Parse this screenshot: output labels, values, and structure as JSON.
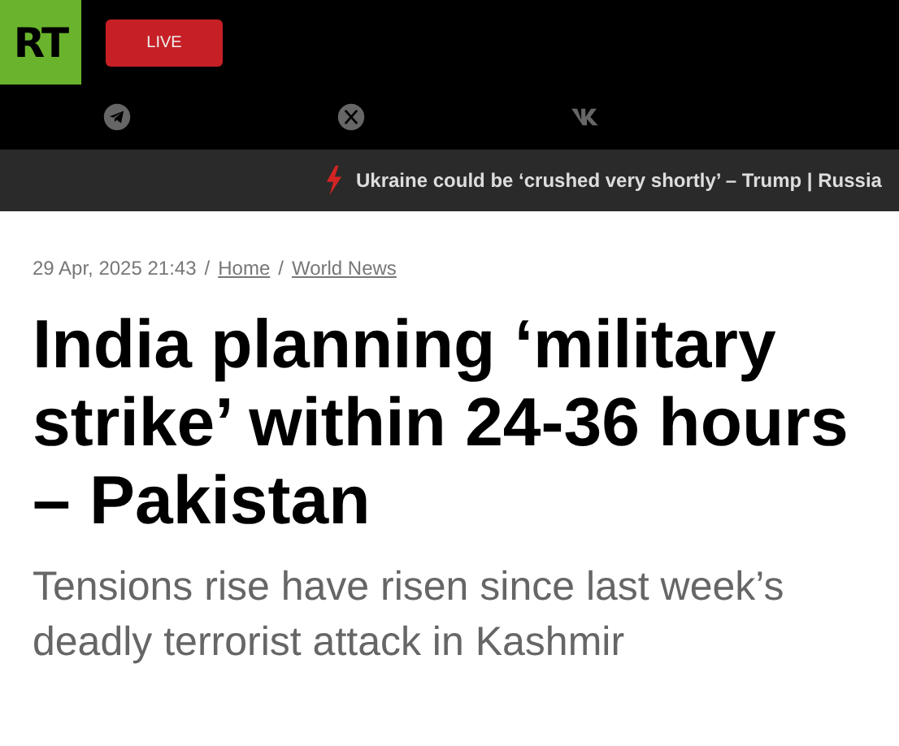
{
  "header": {
    "logo": "RT",
    "live_button": "LIVE"
  },
  "social": [
    {
      "kind": "telegram"
    },
    {
      "kind": "x"
    },
    {
      "kind": "vk"
    }
  ],
  "ticker": {
    "text": "Ukraine could be ‘crushed very shortly’ – Trump | Russia"
  },
  "breadcrumb": {
    "date": "29 Apr, 2025 21:43",
    "separator": "/",
    "links": [
      "Home",
      "World News"
    ]
  },
  "headline": "India planning ‘military strike’ within 24-36 hours – Pakistan",
  "summary": "Tensions rise have risen since last week’s deadly terrorist attack in Kashmir"
}
